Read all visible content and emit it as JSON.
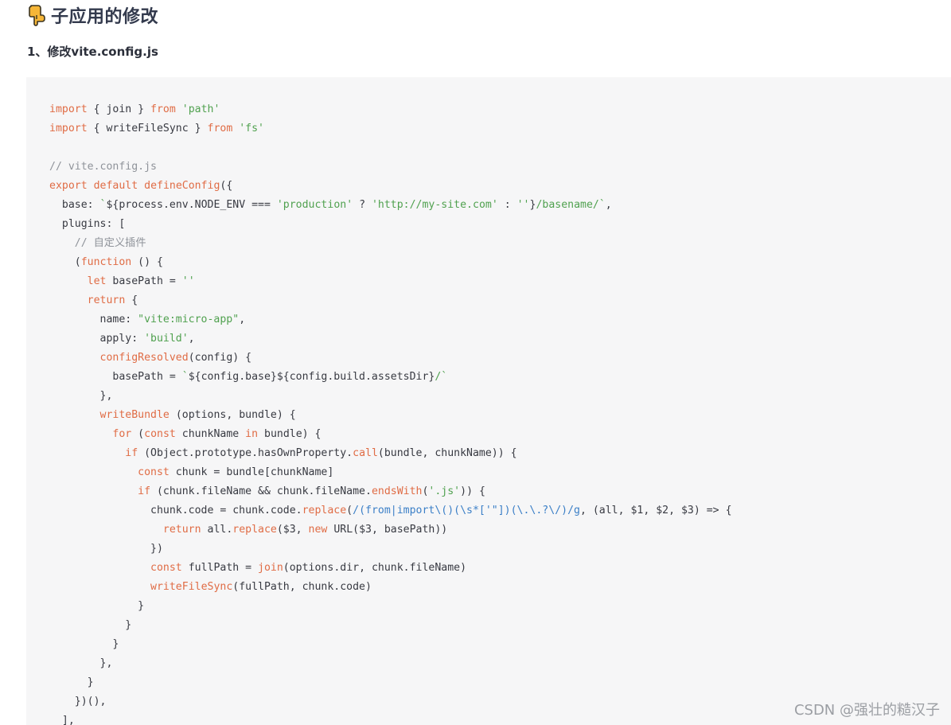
{
  "heading": {
    "icon": "pointing-down-hand-icon",
    "title": "子应用的修改"
  },
  "subheading": "1、修改vite.config.js",
  "code": {
    "language": "javascript",
    "lines": [
      "import { join } from 'path'",
      "import { writeFileSync } from 'fs'",
      "",
      "// vite.config.js",
      "export default defineConfig({",
      "  base: `${process.env.NODE_ENV === 'production' ? 'http://my-site.com' : ''}/basename/`,",
      "  plugins: [",
      "    // 自定义插件",
      "    (function () {",
      "      let basePath = ''",
      "      return {",
      "        name: \"vite:micro-app\",",
      "        apply: 'build',",
      "        configResolved(config) {",
      "          basePath = `${config.base}${config.build.assetsDir}/`",
      "        },",
      "        writeBundle (options, bundle) {",
      "          for (const chunkName in bundle) {",
      "            if (Object.prototype.hasOwnProperty.call(bundle, chunkName)) {",
      "              const chunk = bundle[chunkName]",
      "              if (chunk.fileName && chunk.fileName.endsWith('.js')) {",
      "                chunk.code = chunk.code.replace(/(from|import\\()(\\s*['\"])(\\.\\.?\\/)/g, (all, $1, $2, $3) => {",
      "                  return all.replace($3, new URL($3, basePath))",
      "                })",
      "                const fullPath = join(options.dir, chunk.fileName)",
      "                writeFileSync(fullPath, chunk.code)",
      "              }",
      "            }",
      "          }",
      "        },",
      "      }",
      "    })(),",
      "  ],"
    ]
  },
  "watermark": "CSDN @强壮的糙汉子",
  "colors": {
    "keyword": "#e06c45",
    "string": "#50a14f",
    "comment": "#8f939a",
    "regex": "#3b7fc7",
    "text": "#383a42",
    "code_background": "#f6f6f7"
  }
}
